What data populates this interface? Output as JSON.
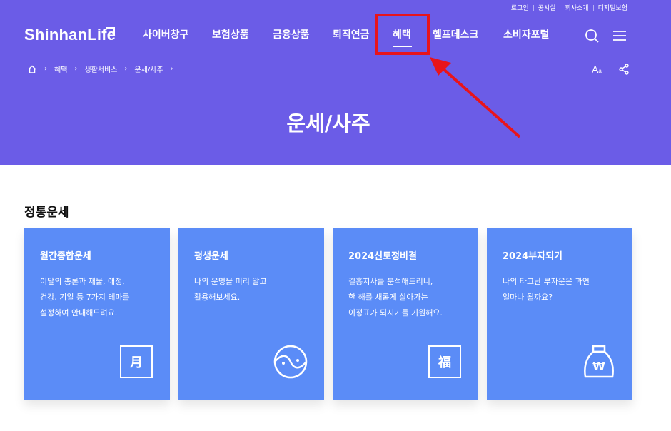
{
  "utility_links": [
    "로그인",
    "공시실",
    "회사소개",
    "디지털보험"
  ],
  "brand": {
    "logo_text": "ShinhanLife"
  },
  "nav": {
    "items": [
      "사이버창구",
      "보험상품",
      "금융상품",
      "퇴직연금",
      "혜택",
      "헬프데스크",
      "소비자포털"
    ],
    "active": "혜택"
  },
  "breadcrumb": [
    "혜택",
    "생활서비스",
    "운세/사주"
  ],
  "tools": {
    "font_size_label": "A",
    "font_size_small": "a"
  },
  "page": {
    "title": "운세/사주"
  },
  "section": {
    "title": "정통운세"
  },
  "cards": [
    {
      "title": "월간종합운세",
      "desc": "이달의 총론과 재물, 애정,\n건강, 기일 등 7가지 테마를\n설정하여 안내해드려요.",
      "icon": "month-char-icon",
      "icon_char": "月"
    },
    {
      "title": "평생운세",
      "desc": "나의 운명을 미리 알고\n활용해보세요.",
      "icon": "yin-yang-icon"
    },
    {
      "title": "2024신토정비결",
      "desc": "길흉지사를 분석해드리니,\n한 해를 새롭게 살아가는\n이정표가 되시기를 기원해요.",
      "icon": "fortune-char-icon",
      "icon_char": "福"
    },
    {
      "title": "2024부자되기",
      "desc": "나의 타고난 부자운은 과연\n얼마나 될까요?",
      "icon": "money-bag-icon",
      "icon_char": "₩"
    }
  ],
  "colors": {
    "hero": "#6b5ce7",
    "card": "#5b8cf7",
    "annotation": "#e8141b"
  }
}
